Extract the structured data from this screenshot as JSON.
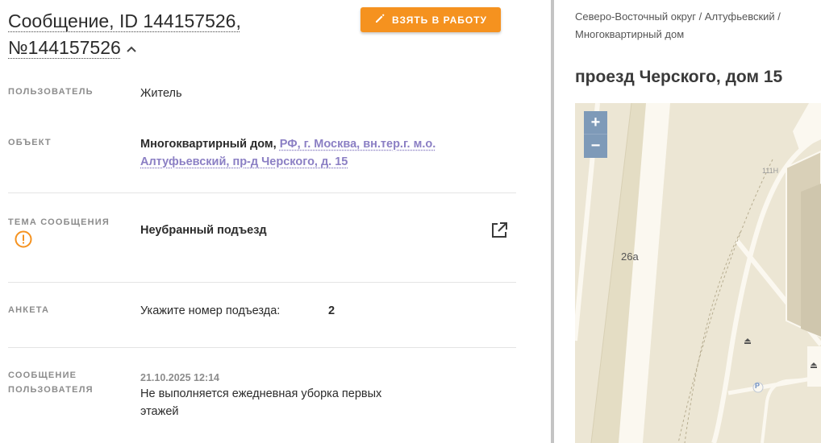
{
  "header": {
    "title_line1": "Сообщение, ID 144157526,",
    "title_line2": "№144157526",
    "take_button": "ВЗЯТЬ В РАБОТУ"
  },
  "fields": {
    "user_label": "ПОЛЬЗОВАТЕЛЬ",
    "user_value": "Житель",
    "object_label": "ОБЪЕКТ",
    "object_type": "Многоквартирный дом,",
    "object_address_line1": "РФ, г. Москва, вн.тер.г. м.о.",
    "object_address_line2": "Алтуфьевский, пр-д Черского, д. 15",
    "topic_label": "ТЕМА СООБЩЕНИЯ",
    "topic_value": "Неубранный подъезд",
    "survey_label": "АНКЕТА",
    "survey_question": "Укажите номер подъезда:",
    "survey_answer": "2",
    "message_label_line1": "СООБЩЕНИЕ",
    "message_label_line2": "ПОЛЬЗОВАТЕЛЯ",
    "message_date": "21.10.2025 12:14",
    "message_text_line1": "Не выполняется ежедневная уборка первых",
    "message_text_line2": "этажей"
  },
  "side": {
    "breadcrumb_line1": "Северо-Восточный округ / Алтуфьевский /",
    "breadcrumb_line2": "Многоквартирный дом",
    "address_title": "проезд Черского, дом 15",
    "map": {
      "zoom_in": "+",
      "zoom_out": "−",
      "building_label": "26а",
      "road_label": "111Н",
      "parking_label": "P"
    }
  },
  "colors": {
    "accent_orange": "#f5921f",
    "link_purple": "#8b7fc4",
    "warning_orange": "#f5921f",
    "map_bg": "#ece6d4",
    "zoom_blue": "#7e9ab8"
  },
  "icons": {
    "take_button": "pencil-icon",
    "collapse": "chevron-up-icon",
    "topic_warning": "exclamation-circle-icon",
    "open_topic": "external-link-icon",
    "map_poi": "poi-icon"
  }
}
